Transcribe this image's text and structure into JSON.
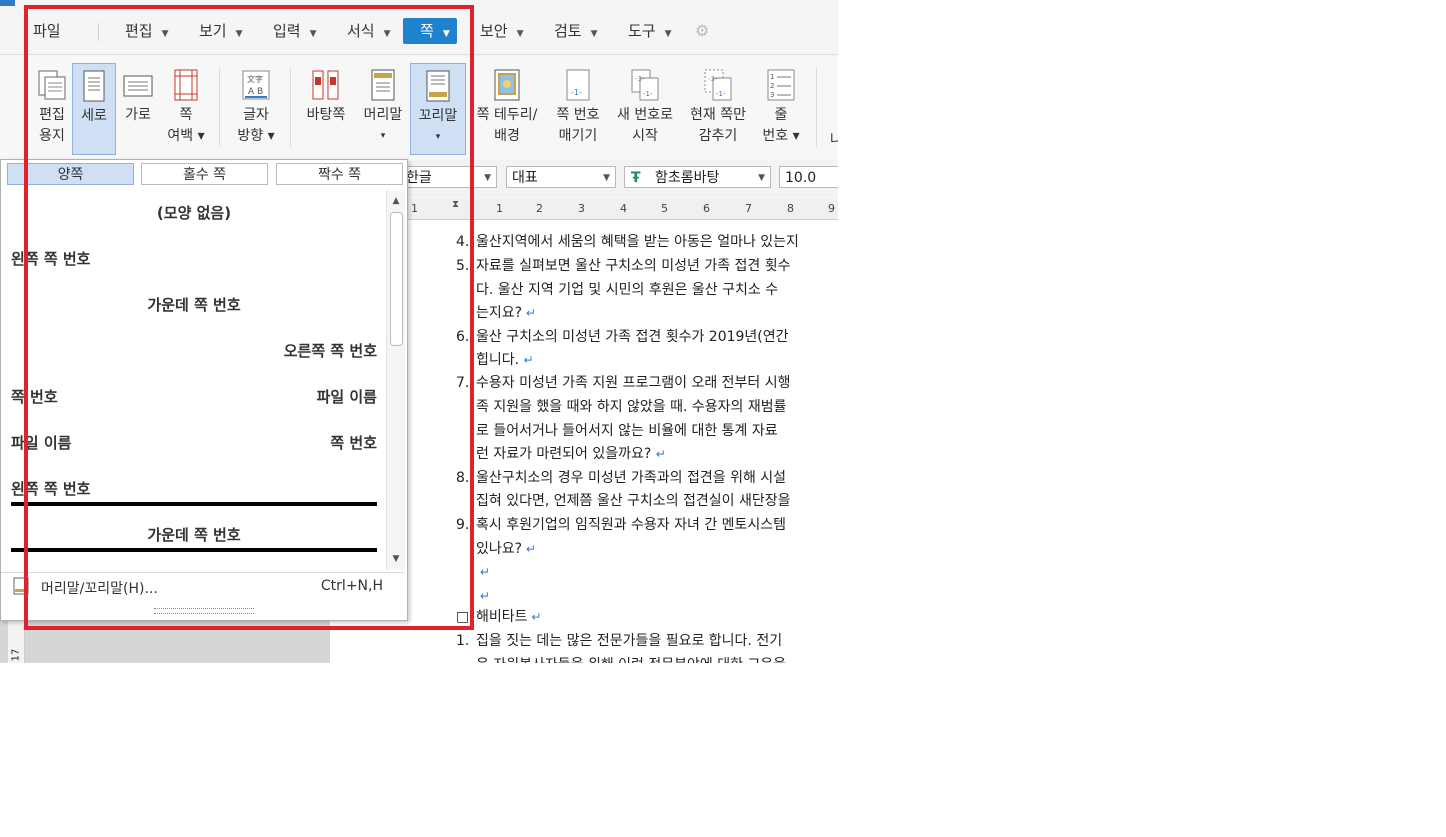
{
  "menubar": {
    "items": [
      {
        "label": "파일"
      },
      {
        "label": "편집"
      },
      {
        "label": "보기"
      },
      {
        "label": "입력"
      },
      {
        "label": "서식"
      },
      {
        "label": "쪽"
      },
      {
        "label": "보안"
      },
      {
        "label": "검토"
      },
      {
        "label": "도구"
      }
    ],
    "active": "쪽"
  },
  "ribbon": {
    "buttons": [
      {
        "line1": "편집",
        "line2": "용지",
        "icon": "page-setup-icon"
      },
      {
        "line1": "세로",
        "line2": "",
        "icon": "portrait-icon"
      },
      {
        "line1": "가로",
        "line2": "",
        "icon": "landscape-icon"
      },
      {
        "line1": "쪽",
        "line2": "여백 ▾",
        "icon": "page-margin-icon"
      },
      {
        "line1": "글자",
        "line2": "방향 ▾",
        "icon": "text-direction-icon"
      },
      {
        "line1": "바탕쪽",
        "line2": "",
        "icon": "master-page-icon"
      },
      {
        "line1": "머리말",
        "line2": "▾",
        "icon": "header-icon"
      },
      {
        "line1": "꼬리말",
        "line2": "▾",
        "icon": "footer-icon"
      },
      {
        "line1": "쪽 테두리/",
        "line2": "배경",
        "icon": "page-border-icon"
      },
      {
        "line1": "쪽 번호",
        "line2": "매기기",
        "icon": "page-number-icon"
      },
      {
        "line1": "새 번호로",
        "line2": "시작",
        "icon": "new-number-icon"
      },
      {
        "line1": "현재 쪽만",
        "line2": "감추기",
        "icon": "hide-current-icon"
      },
      {
        "line1": "줄",
        "line2": "번호 ▾",
        "icon": "line-number-icon"
      }
    ],
    "cut_label": "나"
  },
  "format_bar": {
    "language": "한글",
    "style": "대표",
    "font": "함초롬바탕",
    "size": "10.0"
  },
  "ruler": {
    "ticks": [
      "1",
      "1",
      "2",
      "3",
      "4",
      "5",
      "6",
      "7",
      "8",
      "9"
    ]
  },
  "vruler": {
    "label": "17"
  },
  "dropdown": {
    "tabs": [
      "양쪽",
      "홀수 쪽",
      "짝수 쪽"
    ],
    "active_tab": "양쪽",
    "presets": [
      {
        "left": "",
        "center": "(모양 없음)",
        "right": "",
        "bar": false
      },
      {
        "left": "왼쪽 쪽 번호",
        "center": "",
        "right": "",
        "bar": false
      },
      {
        "left": "",
        "center": "가운데 쪽 번호",
        "right": "",
        "bar": false
      },
      {
        "left": "",
        "center": "",
        "right": "오른쪽 쪽 번호",
        "bar": false
      },
      {
        "left": "쪽 번호",
        "center": "",
        "right": "파일 이름",
        "bar": false
      },
      {
        "left": "파일 이름",
        "center": "",
        "right": "쪽 번호",
        "bar": false
      },
      {
        "left": "왼쪽 쪽 번호",
        "center": "",
        "right": "",
        "bar": true
      },
      {
        "left": "",
        "center": "가운데 쪽 번호",
        "right": "",
        "bar": true
      }
    ],
    "footer_label": "머리말/꼬리말(H)...",
    "footer_shortcut": "Ctrl+N,H"
  },
  "document": {
    "lines": [
      {
        "num": "4.",
        "text": "울산지역에서 세움의 혜택을 받는 아동은 얼마나 있는지",
        "mark": false
      },
      {
        "num": "5.",
        "text": "자료를 실펴보면 울산 구치소의 미성년 가족 접견 횟수",
        "mark": false
      },
      {
        "num": "",
        "text": "다. 울산 지역 기업 및 시민의 후원은 울산 구치소 수",
        "mark": false
      },
      {
        "num": "",
        "text": "는지요?",
        "mark": true
      },
      {
        "num": "6.",
        "text": "울산 구치소의 미성년 가족 접견 횟수가 2019년(연간",
        "mark": false
      },
      {
        "num": "",
        "text": "힙니다. ",
        "mark": true
      },
      {
        "num": "7.",
        "text": "수용자 미성년 가족 지원 프로그램이 오래 전부터 시행",
        "mark": false
      },
      {
        "num": "",
        "text": "족 지원을 했을 때와 하지 않았을 때. 수용자의 재범률",
        "mark": false
      },
      {
        "num": "",
        "text": "로 들어서거나 들어서지 않는 비율에 대한 통계 자료",
        "mark": false
      },
      {
        "num": "",
        "text": "런 자료가 마련되어 있을까요? ",
        "mark": true
      },
      {
        "num": "8.",
        "text": "울산구치소의 경우 미성년 가족과의 접견을 위해 시설",
        "mark": false
      },
      {
        "num": "",
        "text": "집혀 있다면, 언제쯤 울산 구치소의 접견실이 새단장을",
        "mark": false
      },
      {
        "num": "9.",
        "text": "혹시 후원기업의 임직원과 수용자 자녀 간 멘토시스템",
        "mark": false
      },
      {
        "num": "",
        "text": "있나요?",
        "mark": true
      },
      {
        "num": "",
        "text": "",
        "mark": true
      },
      {
        "num": "",
        "text": "",
        "mark": true
      },
      {
        "num": "□",
        "text": "해비타트",
        "mark": true
      },
      {
        "num": "1.",
        "text": "집을 짓는 데는 많은 전문가들을 필요로 합니다. 전기",
        "mark": false
      },
      {
        "num": "",
        "text": "은 자원봉사자들을 위해 이런 전문분야에 대한 교육을",
        "mark": false
      }
    ]
  }
}
